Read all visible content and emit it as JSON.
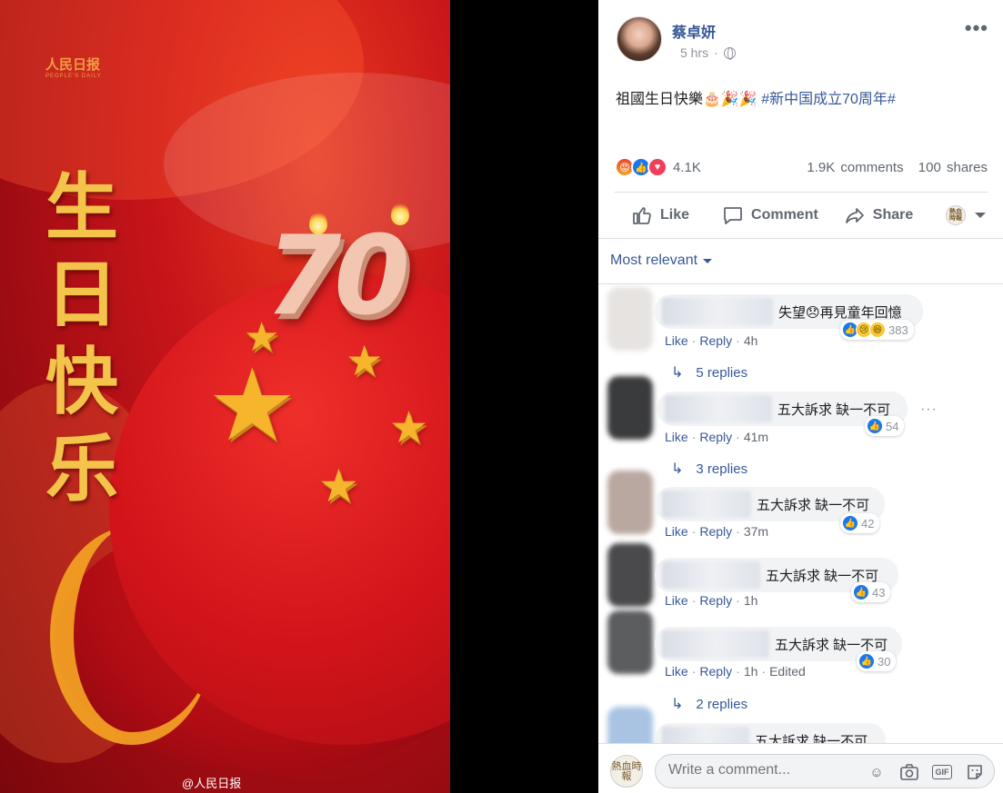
{
  "photo": {
    "watermark_top": "人民日报",
    "watermark_top_sub": "PEOPLE'S DAILY",
    "watermark_bottom": "@人民日报",
    "vertical_text": "生日快乐",
    "number": "70"
  },
  "post": {
    "author": "蔡卓妍",
    "time": "5 hrs",
    "text": "祖國生日快樂🎂🎉🎉 ",
    "hashtag": "#新中国成立70周年#",
    "reaction_count": "4.1K",
    "comments_count": "1.9K comments",
    "shares_count": "100 shares"
  },
  "actions": {
    "like": "Like",
    "comment": "Comment",
    "share": "Share"
  },
  "sort_label": "Most relevant",
  "comments": [
    {
      "text": "失望😞再見童年回憶",
      "count": "383",
      "time": "4h",
      "replies": "5 replies"
    },
    {
      "text": "五大訴求 缺一不可",
      "count": "54",
      "time": "41m",
      "replies": "3 replies"
    },
    {
      "text": "五大訴求 缺一不可",
      "count": "42",
      "time": "37m"
    },
    {
      "text": "五大訴求 缺一不可",
      "count": "43",
      "time": "1h"
    },
    {
      "text": "五大訴求 缺一不可",
      "count": "30",
      "time": "1h",
      "edited": "Edited",
      "replies": "2 replies"
    },
    {
      "text": "五大訴求 缺一不可"
    }
  ],
  "comment_links": {
    "like": "Like",
    "reply": "Reply"
  },
  "write": {
    "placeholder": "Write a comment...",
    "avatar_text": "熱血時報"
  },
  "colors": {
    "link": "#385898",
    "like_blue": "#1877f2",
    "love": "#f33e58"
  }
}
